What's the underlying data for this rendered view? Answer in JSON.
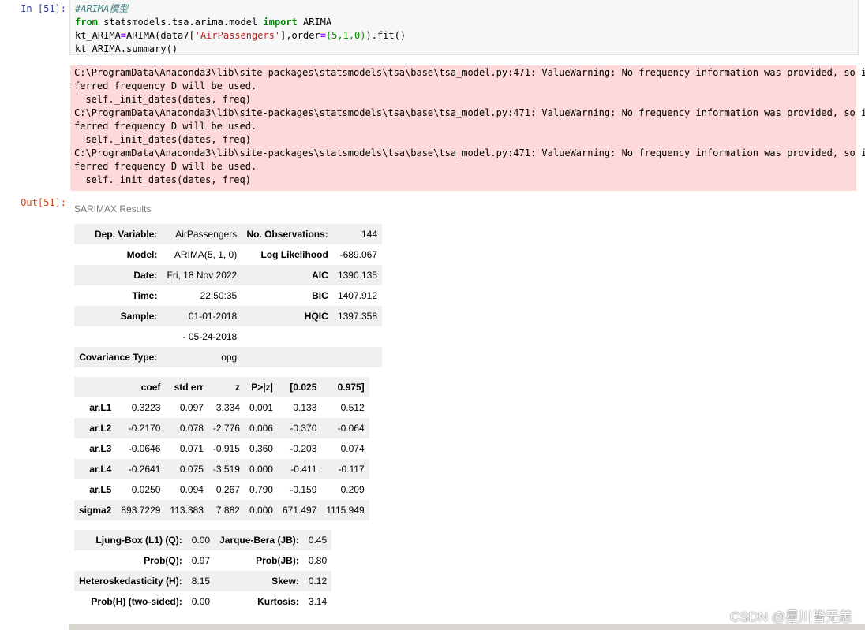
{
  "input_prompt": "In  [51]:",
  "output_prompt": "Out[51]:",
  "code": {
    "line1_comment": "#ARIMA模型",
    "line2": {
      "kw_from": "from",
      "module": " statsmodels.tsa.arima.model ",
      "kw_import": "import",
      "name": " ARIMA"
    },
    "line3": {
      "prefix": "kt_ARIMA",
      "eq": "=",
      "call": "ARIMA(data7[",
      "str": "'AirPassengers'",
      "mid": "],order",
      "eq2": "=",
      "nums": "(5,1,0)",
      "end": ").fit()"
    },
    "line4": "kt_ARIMA.summary()"
  },
  "stderr_text": "C:\\ProgramData\\Anaconda3\\lib\\site-packages\\statsmodels\\tsa\\base\\tsa_model.py:471: ValueWarning: No frequency information was provided, so in\nferred frequency D will be used.\n  self._init_dates(dates, freq)\nC:\\ProgramData\\Anaconda3\\lib\\site-packages\\statsmodels\\tsa\\base\\tsa_model.py:471: ValueWarning: No frequency information was provided, so in\nferred frequency D will be used.\n  self._init_dates(dates, freq)\nC:\\ProgramData\\Anaconda3\\lib\\site-packages\\statsmodels\\tsa\\base\\tsa_model.py:471: ValueWarning: No frequency information was provided, so in\nferred frequency D will be used.\n  self._init_dates(dates, freq)",
  "summary": {
    "caption": "SARIMAX Results",
    "header_rows": [
      [
        "Dep. Variable:",
        "AirPassengers",
        "No. Observations:",
        "144"
      ],
      [
        "Model:",
        "ARIMA(5, 1, 0)",
        "Log Likelihood",
        "-689.067"
      ],
      [
        "Date:",
        "Fri, 18 Nov 2022",
        "AIC",
        "1390.135"
      ],
      [
        "Time:",
        "22:50:35",
        "BIC",
        "1407.912"
      ],
      [
        "Sample:",
        "01-01-2018",
        "HQIC",
        "1397.358"
      ],
      [
        "",
        "- 05-24-2018",
        "",
        ""
      ],
      [
        "Covariance Type:",
        "opg",
        "",
        ""
      ]
    ],
    "coef_header": [
      "",
      "coef",
      "std err",
      "z",
      "P>|z|",
      "[0.025",
      "0.975]"
    ],
    "coef_rows": [
      [
        "ar.L1",
        "0.3223",
        "0.097",
        "3.334",
        "0.001",
        "0.133",
        "0.512"
      ],
      [
        "ar.L2",
        "-0.2170",
        "0.078",
        "-2.776",
        "0.006",
        "-0.370",
        "-0.064"
      ],
      [
        "ar.L3",
        "-0.0646",
        "0.071",
        "-0.915",
        "0.360",
        "-0.203",
        "0.074"
      ],
      [
        "ar.L4",
        "-0.2641",
        "0.075",
        "-3.519",
        "0.000",
        "-0.411",
        "-0.117"
      ],
      [
        "ar.L5",
        "0.0250",
        "0.094",
        "0.267",
        "0.790",
        "-0.159",
        "0.209"
      ],
      [
        "sigma2",
        "893.7229",
        "113.383",
        "7.882",
        "0.000",
        "671.497",
        "1115.949"
      ]
    ],
    "diag_rows": [
      [
        "Ljung-Box (L1) (Q):",
        "0.00",
        "Jarque-Bera (JB):",
        "0.45"
      ],
      [
        "Prob(Q):",
        "0.97",
        "Prob(JB):",
        "0.80"
      ],
      [
        "Heteroskedasticity (H):",
        "8.15",
        "Skew:",
        "0.12"
      ],
      [
        "Prob(H) (two-sided):",
        "0.00",
        "Kurtosis:",
        "3.14"
      ]
    ]
  },
  "watermark": "CSDN @星川皆无恙"
}
